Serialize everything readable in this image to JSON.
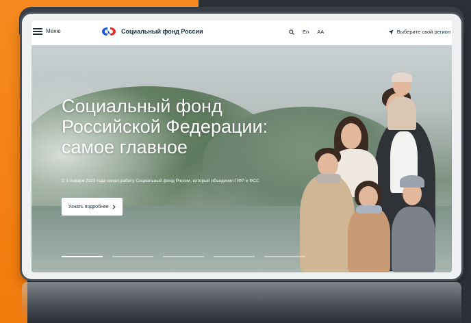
{
  "header": {
    "menu_label": "Меню",
    "logo_text": "Социальный фонд России",
    "lang_label": "En",
    "font_size_label": "AA",
    "region_label": "Выберите свой регион"
  },
  "hero": {
    "title": "Социальный фонд Российской Федерации: самое главное",
    "subtitle": "С 1 января 2023 года начал работу Социальный фонд России, который объединил ПФР и ФСС",
    "button_label": "Узнать подробнее",
    "slides_total": 5,
    "slide_active": 1
  },
  "colors": {
    "brand_blue": "#1c5bd9",
    "brand_red": "#e6302f",
    "accent_orange": "#f68a1e",
    "text_dark": "#1c2a39"
  },
  "icons": {
    "menu": "hamburger-icon",
    "search": "search-icon",
    "region": "location-arrow-icon",
    "button_arrow": "chevron-right-icon"
  }
}
